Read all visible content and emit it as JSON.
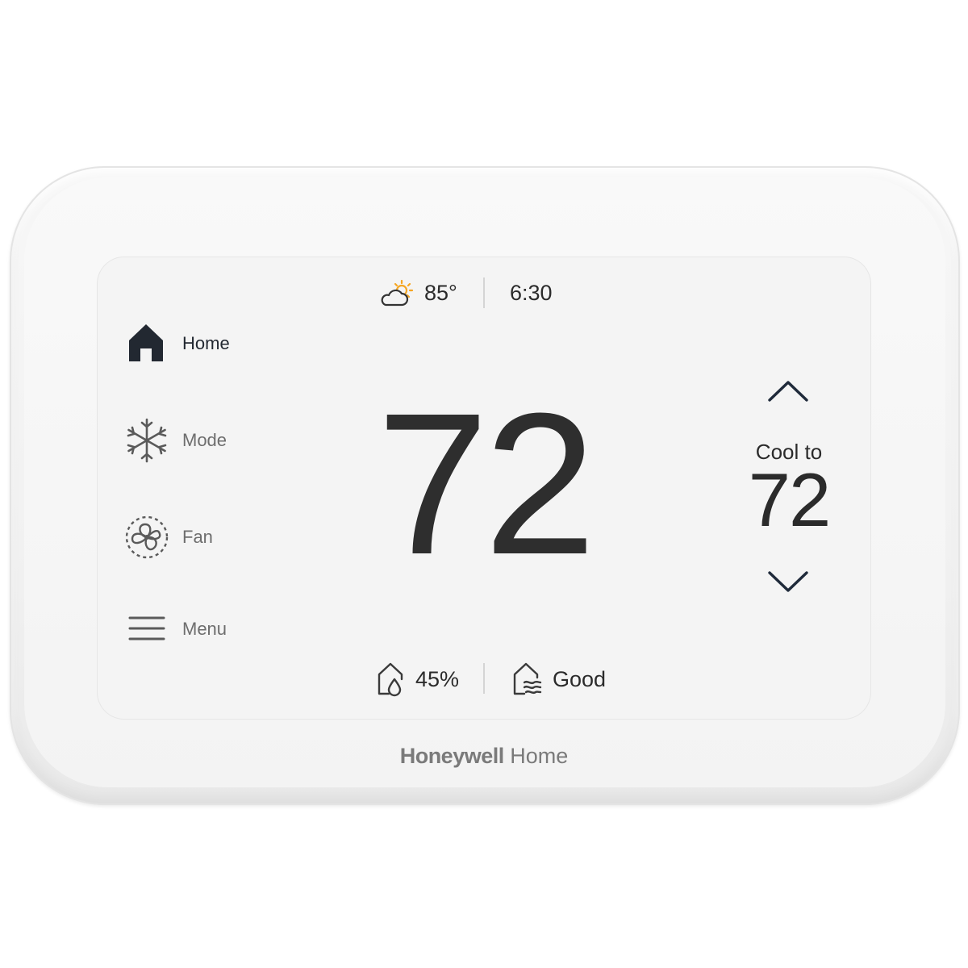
{
  "status_bar": {
    "weather_icon": "partly-sunny-icon",
    "outdoor_temp": "85°",
    "time": "6:30"
  },
  "nav": {
    "items": [
      {
        "label": "Home",
        "icon": "home-icon",
        "active": true
      },
      {
        "label": "Mode",
        "icon": "snowflake-icon",
        "active": false
      },
      {
        "label": "Fan",
        "icon": "fan-icon",
        "active": false
      },
      {
        "label": "Menu",
        "icon": "hamburger-menu-icon",
        "active": false
      }
    ]
  },
  "main": {
    "indoor_temp": "72"
  },
  "setpoint": {
    "label": "Cool to",
    "value": "72",
    "up_icon": "chevron-up-icon",
    "down_icon": "chevron-down-icon"
  },
  "bottom_bar": {
    "humidity_icon": "humidity-icon",
    "humidity": "45%",
    "air_quality_icon": "air-quality-icon",
    "air_quality": "Good"
  },
  "brand": {
    "name_bold": "Honeywell",
    "name_light": "Home"
  },
  "colors": {
    "accent_sun": "#f5a623",
    "nav_active": "#222831",
    "text": "#2b2b2b",
    "muted": "#6d6d6d"
  }
}
